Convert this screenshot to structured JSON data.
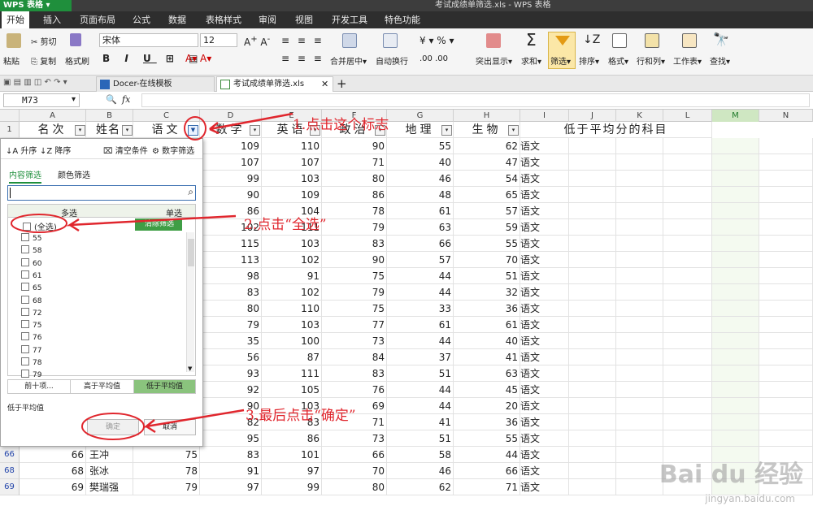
{
  "app": {
    "name": "WPS 表格",
    "document_title": "考试成绩单筛选.xls - WPS 表格"
  },
  "menu": [
    "开始",
    "插入",
    "页面布局",
    "公式",
    "数据",
    "表格样式",
    "审阅",
    "视图",
    "开发工具",
    "特色功能"
  ],
  "ribbon": {
    "paste": "粘贴",
    "cut": "剪切",
    "copy": "复制",
    "format_painter": "格式刷",
    "font": "宋体",
    "font_size": "12",
    "merge": "合并居中",
    "wrap": "自动换行",
    "highlight": "突出显示",
    "sum": "求和",
    "filter": "筛选",
    "sort": "排序",
    "format": "格式",
    "rows_cols": "行和列",
    "worksheet": "工作表",
    "find": "查找",
    "percent": "%"
  },
  "tabs": {
    "template": "Docer-在线模板",
    "file": "考试成绩单筛选.xls"
  },
  "formula": {
    "name_box": "M73",
    "fx": "fx"
  },
  "columns": [
    "A",
    "B",
    "C",
    "D",
    "E",
    "F",
    "G",
    "H",
    "I",
    "J",
    "K",
    "L",
    "M",
    "N"
  ],
  "header_row": {
    "num": "1",
    "a": "名次",
    "b": "姓名",
    "c": "语文",
    "d": "数学",
    "e": "英语",
    "f": "政治",
    "g": "地理",
    "h": "生物",
    "ij": "低于平均分的科目"
  },
  "rows": [
    {
      "d": "109",
      "e": "110",
      "f": "90",
      "g": "55",
      "h": "62",
      "i": "语文"
    },
    {
      "d": "107",
      "e": "107",
      "f": "71",
      "g": "40",
      "h": "47",
      "i": "语文"
    },
    {
      "d": "99",
      "e": "103",
      "f": "80",
      "g": "46",
      "h": "54",
      "i": "语文"
    },
    {
      "d": "90",
      "e": "109",
      "f": "86",
      "g": "48",
      "h": "65",
      "i": "语文"
    },
    {
      "d": "86",
      "e": "104",
      "f": "78",
      "g": "61",
      "h": "57",
      "i": "语文"
    },
    {
      "d": "102",
      "e": "111",
      "f": "79",
      "g": "63",
      "h": "59",
      "i": "语文"
    },
    {
      "d": "115",
      "e": "103",
      "f": "83",
      "g": "66",
      "h": "55",
      "i": "语文"
    },
    {
      "d": "113",
      "e": "102",
      "f": "90",
      "g": "57",
      "h": "70",
      "i": "语文"
    },
    {
      "d": "98",
      "e": "91",
      "f": "75",
      "g": "44",
      "h": "51",
      "i": "语文"
    },
    {
      "d": "83",
      "e": "102",
      "f": "79",
      "g": "44",
      "h": "32",
      "i": "语文"
    },
    {
      "d": "80",
      "e": "110",
      "f": "75",
      "g": "33",
      "h": "36",
      "i": "语文"
    },
    {
      "d": "79",
      "e": "103",
      "f": "77",
      "g": "61",
      "h": "61",
      "i": "语文"
    },
    {
      "d": "35",
      "e": "100",
      "f": "73",
      "g": "44",
      "h": "40",
      "i": "语文"
    },
    {
      "d": "56",
      "e": "87",
      "f": "84",
      "g": "37",
      "h": "41",
      "i": "语文"
    },
    {
      "d": "93",
      "e": "111",
      "f": "83",
      "g": "51",
      "h": "63",
      "i": "语文"
    },
    {
      "d": "92",
      "e": "105",
      "f": "76",
      "g": "44",
      "h": "45",
      "i": "语文"
    },
    {
      "d": "90",
      "e": "103",
      "f": "69",
      "g": "44",
      "h": "20",
      "i": "语文"
    },
    {
      "d": "82",
      "e": "83",
      "f": "71",
      "g": "41",
      "h": "36",
      "i": "语文"
    },
    {
      "d": "95",
      "e": "86",
      "f": "73",
      "g": "51",
      "h": "55",
      "i": "语文"
    },
    {
      "r": "66",
      "a": "66",
      "b": "王冲",
      "c": "75",
      "d": "83",
      "e": "101",
      "f": "66",
      "g": "58",
      "h": "44",
      "i": "语文"
    },
    {
      "r": "68",
      "a": "68",
      "b": "张冰",
      "c": "78",
      "d": "91",
      "e": "97",
      "f": "70",
      "g": "46",
      "h": "66",
      "i": "语文"
    },
    {
      "r": "69",
      "a": "69",
      "b": "樊瑞强",
      "c": "79",
      "d": "97",
      "e": "99",
      "f": "80",
      "g": "62",
      "h": "71",
      "i": "语文"
    }
  ],
  "filter_panel": {
    "sort_asc": "升序",
    "sort_desc": "降序",
    "clear": "清空条件",
    "number_filter": "数字筛选",
    "tab_content": "内容筛选",
    "tab_color": "颜色筛选",
    "col_multi": "多选",
    "col_single": "单选",
    "select_all": "(全选)",
    "clear_filter": "清除筛选",
    "values": [
      "55",
      "58",
      "60",
      "61",
      "65",
      "68",
      "72",
      "75",
      "76",
      "77",
      "78",
      "79"
    ],
    "btn_top10": "前十项...",
    "btn_above": "高于平均值",
    "btn_below": "低于平均值",
    "status": "低于平均值",
    "ok": "确定",
    "cancel": "取消"
  },
  "annotations": {
    "step1": "1.点击这个标志",
    "step2": "2.点击“全选”",
    "step3": "3.最后点击“确定”"
  },
  "watermark": {
    "brand": "Bai du 经验",
    "url": "jingyan.baidu.com"
  },
  "colors": {
    "accent_green": "#1f8f3c",
    "annotation_red": "#e0262d"
  }
}
